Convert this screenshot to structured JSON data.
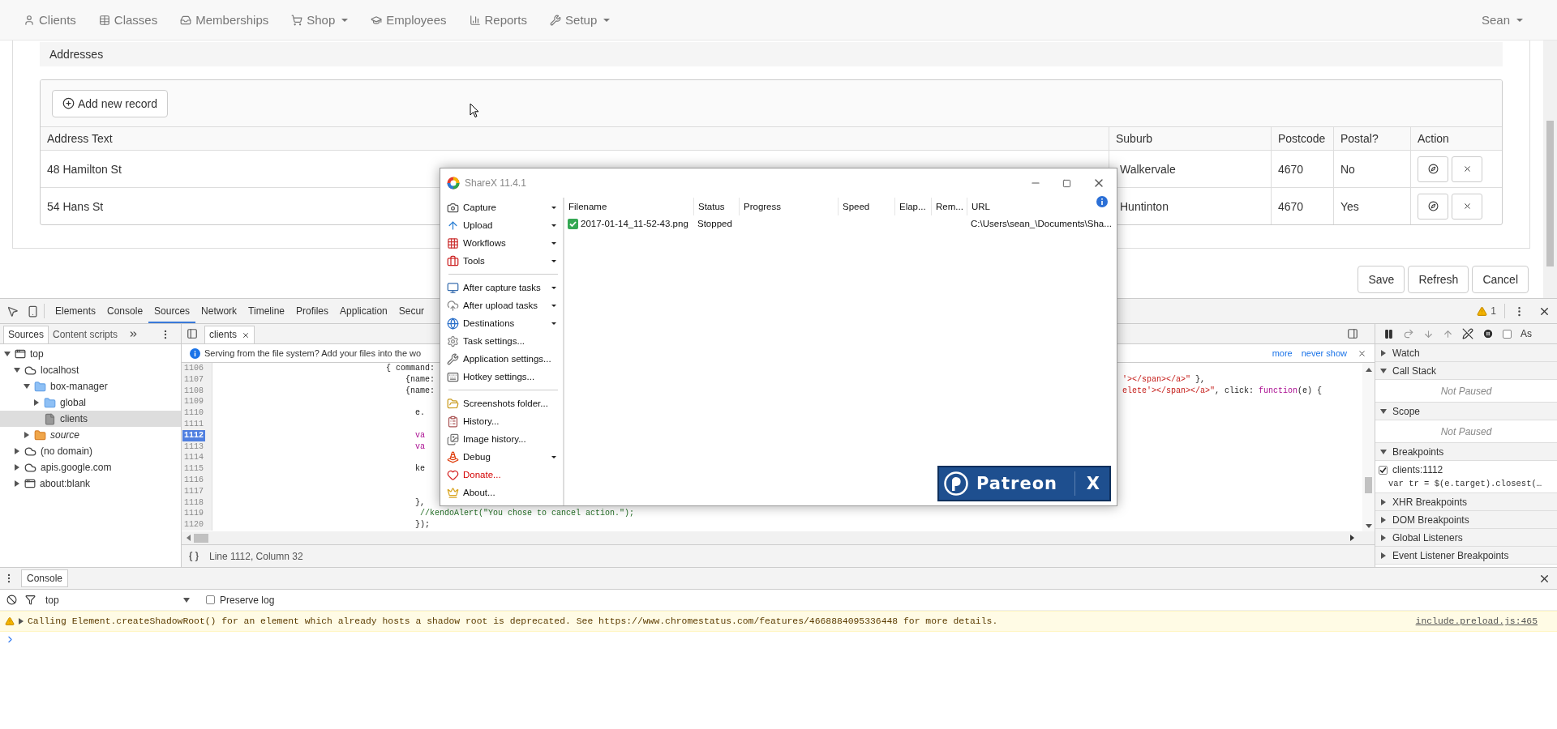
{
  "nav": {
    "items": [
      {
        "label": "Clients",
        "dropdown": false
      },
      {
        "label": "Classes",
        "dropdown": false
      },
      {
        "label": "Memberships",
        "dropdown": false
      },
      {
        "label": "Shop",
        "dropdown": true
      },
      {
        "label": "Employees",
        "dropdown": false
      },
      {
        "label": "Reports",
        "dropdown": false
      },
      {
        "label": "Setup",
        "dropdown": true
      }
    ],
    "user": {
      "label": "Sean",
      "dropdown": true
    }
  },
  "addresses": {
    "title": "Addresses",
    "add_button": "Add new record",
    "columns": [
      "Address Text",
      "Suburb",
      "Postcode",
      "Postal?",
      "Action"
    ],
    "rows": [
      {
        "address": "48 Hamilton St",
        "suburb": "Walkervale",
        "postcode": "4670",
        "postal": "No"
      },
      {
        "address": "54 Hans St",
        "suburb": "Huntinton",
        "postcode": "4670",
        "postal": "Yes"
      }
    ]
  },
  "form_buttons": [
    "Save",
    "Refresh",
    "Cancel"
  ],
  "devtools": {
    "tabs": [
      {
        "label": "Elements",
        "selected": false
      },
      {
        "label": "Console",
        "selected": false
      },
      {
        "label": "Sources",
        "selected": true
      },
      {
        "label": "Network",
        "selected": false
      },
      {
        "label": "Timeline",
        "selected": false
      },
      {
        "label": "Profiles",
        "selected": false
      },
      {
        "label": "Application",
        "selected": false
      },
      {
        "label": "Secur",
        "selected": false
      }
    ],
    "warning_count": "1",
    "navigator_tabs": [
      {
        "label": "Sources",
        "selected": true
      },
      {
        "label": "Content scripts",
        "selected": false
      }
    ],
    "tree": [
      {
        "label": "top",
        "kind": "frame",
        "expanded": true,
        "selected": false,
        "children": [
          {
            "label": "localhost",
            "kind": "domain",
            "expanded": true,
            "selected": false,
            "children": [
              {
                "label": "box-manager",
                "kind": "folder",
                "expanded": true,
                "selected": false,
                "children": [
                  {
                    "label": "global",
                    "kind": "folder",
                    "expanded": false,
                    "selected": false
                  },
                  {
                    "label": "clients",
                    "kind": "file",
                    "selected": true
                  }
                ]
              },
              {
                "label": "source",
                "kind": "source",
                "expanded": false,
                "selected": false
              }
            ]
          },
          {
            "label": "(no domain)",
            "kind": "domain",
            "expanded": false,
            "selected": false
          },
          {
            "label": "apis.google.com",
            "kind": "domain",
            "expanded": false,
            "selected": false
          },
          {
            "label": "about:blank",
            "kind": "frame",
            "expanded": false,
            "selected": false
          }
        ]
      }
    ],
    "editor_tab": "clients",
    "infobar": {
      "text": "Serving from the file system? Add your files into the wo",
      "links": [
        "more",
        "never show"
      ]
    },
    "lines": [
      {
        "number": "1106",
        "breakpoint": false,
        "left": [
          {
            "text": "                                   { command:",
            "kind": "plain"
          }
        ]
      },
      {
        "number": "1107",
        "breakpoint": false,
        "left": [
          {
            "text": "                                       {name:",
            "kind": "plain"
          }
        ],
        "right": [
          {
            "text": "'></span></a>\"",
            "kind": "string"
          },
          {
            "text": " },",
            "kind": "plain"
          }
        ]
      },
      {
        "number": "1108",
        "breakpoint": false,
        "left": [
          {
            "text": "                                       {name:",
            "kind": "plain"
          }
        ],
        "right": [
          {
            "text": "elete'></span></a>\"",
            "kind": "string"
          },
          {
            "text": ", click: ",
            "kind": "plain"
          },
          {
            "text": "function",
            "kind": "keyword"
          },
          {
            "text": "(e) {",
            "kind": "plain"
          }
        ]
      },
      {
        "number": "1109",
        "breakpoint": false
      },
      {
        "number": "1110",
        "breakpoint": false,
        "left": [
          {
            "text": "                                         e.",
            "kind": "plain"
          }
        ]
      },
      {
        "number": "1111",
        "breakpoint": false
      },
      {
        "number": "1112",
        "breakpoint": true,
        "left": [
          {
            "text": "                                         va",
            "kind": "keyword"
          }
        ]
      },
      {
        "number": "1113",
        "breakpoint": false,
        "left": [
          {
            "text": "                                         va",
            "kind": "keyword"
          }
        ]
      },
      {
        "number": "1114",
        "breakpoint": false
      },
      {
        "number": "1115",
        "breakpoint": false,
        "left": [
          {
            "text": "                                         ke",
            "kind": "plain"
          }
        ]
      },
      {
        "number": "1116",
        "breakpoint": false
      },
      {
        "number": "1117",
        "breakpoint": false
      },
      {
        "number": "1118",
        "breakpoint": false,
        "left": [
          {
            "text": "                                         },",
            "kind": "plain"
          }
        ]
      },
      {
        "number": "1119",
        "breakpoint": false,
        "left": [
          {
            "text": "                                          //kendoAlert(\"You chose to cancel action.\");",
            "kind": "comment"
          }
        ]
      },
      {
        "number": "1120",
        "breakpoint": false,
        "left": [
          {
            "text": "                                         });",
            "kind": "plain"
          }
        ]
      }
    ],
    "status": "Line 1112, Column 32",
    "async": {
      "label": "As",
      "checked": false
    },
    "sections": [
      {
        "title": "Watch",
        "expanded": false
      },
      {
        "title": "Call Stack",
        "expanded": true,
        "message": "Not Paused"
      },
      {
        "title": "Scope",
        "expanded": true,
        "message": "Not Paused"
      },
      {
        "title": "Breakpoints",
        "expanded": true,
        "breakpoints": [
          {
            "location": "clients:1112",
            "code": "var tr = $(e.target).closest(…",
            "checked": true
          }
        ]
      },
      {
        "title": "XHR Breakpoints",
        "expanded": false
      },
      {
        "title": "DOM Breakpoints",
        "expanded": false
      },
      {
        "title": "Global Listeners",
        "expanded": false
      },
      {
        "title": "Event Listener Breakpoints",
        "expanded": false
      }
    ]
  },
  "console": {
    "tab": "Console",
    "context": "top",
    "preserve_log": {
      "label": "Preserve log",
      "checked": false
    },
    "messages": [
      {
        "kind": "warning",
        "text": "Calling Element.createShadowRoot() for an element which already hosts a shadow root is deprecated. See https://www.chromestatus.com/features/4668884095336448 for more details.",
        "source": "include.preload.js:465"
      }
    ]
  },
  "sharex": {
    "title": "ShareX 11.4.1",
    "menu": [
      {
        "kind": "item",
        "label": "Capture",
        "submenu": true,
        "accent": false
      },
      {
        "kind": "item",
        "label": "Upload",
        "submenu": true,
        "accent": false
      },
      {
        "kind": "item",
        "label": "Workflows",
        "submenu": true,
        "accent": false
      },
      {
        "kind": "item",
        "label": "Tools",
        "submenu": true,
        "accent": false
      },
      {
        "kind": "separator"
      },
      {
        "kind": "item",
        "label": "After capture tasks",
        "submenu": true,
        "accent": false
      },
      {
        "kind": "item",
        "label": "After upload tasks",
        "submenu": true,
        "accent": false
      },
      {
        "kind": "item",
        "label": "Destinations",
        "submenu": true,
        "accent": false
      },
      {
        "kind": "item",
        "label": "Task settings...",
        "submenu": false,
        "accent": false
      },
      {
        "kind": "item",
        "label": "Application settings...",
        "submenu": false,
        "accent": false
      },
      {
        "kind": "item",
        "label": "Hotkey settings...",
        "submenu": false,
        "accent": false
      },
      {
        "kind": "separator"
      },
      {
        "kind": "item",
        "label": "Screenshots folder...",
        "submenu": false,
        "accent": false
      },
      {
        "kind": "item",
        "label": "History...",
        "submenu": false,
        "accent": false
      },
      {
        "kind": "item",
        "label": "Image history...",
        "submenu": false,
        "accent": false
      },
      {
        "kind": "item",
        "label": "Debug",
        "submenu": true,
        "accent": false
      },
      {
        "kind": "item",
        "label": "Donate...",
        "submenu": false,
        "accent": true
      },
      {
        "kind": "item",
        "label": "About...",
        "submenu": false,
        "accent": false
      }
    ],
    "columns": [
      "Filename",
      "Status",
      "Progress",
      "Speed",
      "Elap...",
      "Rem...",
      "URL"
    ],
    "tasks": [
      {
        "filename": "2017-01-14_11-52-43.png",
        "status": "Stopped",
        "url": "C:\\Users\\sean_\\Documents\\Sha...",
        "done": true
      }
    ],
    "banner": {
      "title": "Patreon",
      "mark": "X"
    }
  }
}
